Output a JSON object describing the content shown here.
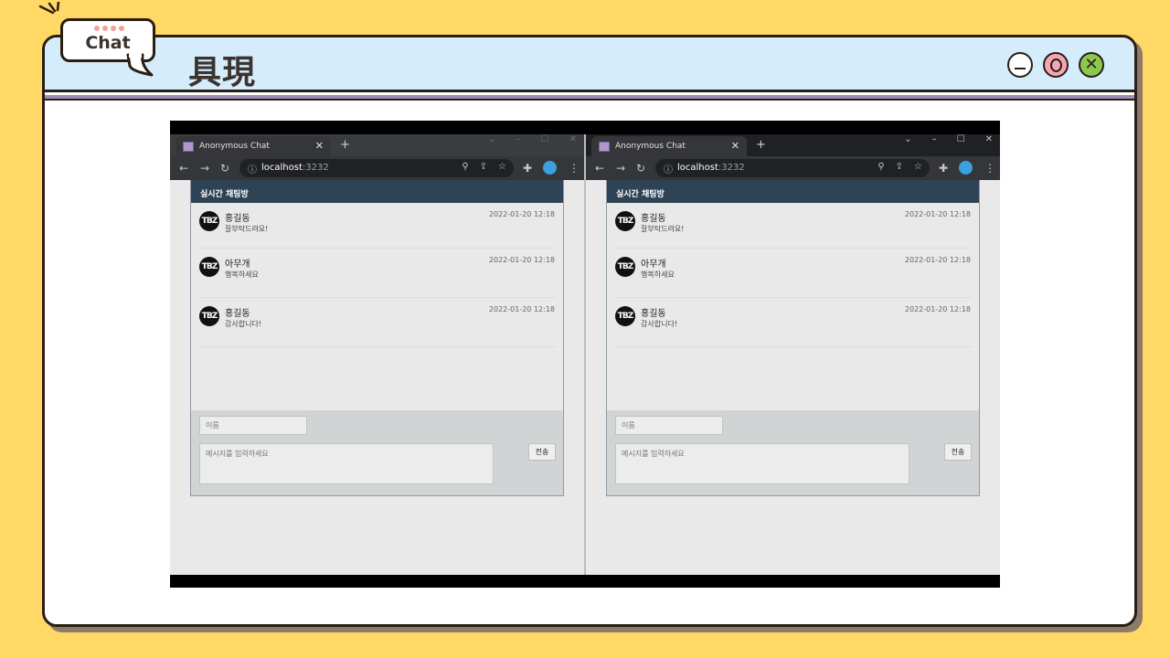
{
  "slide": {
    "title": "具現",
    "sticker_label": "Chat"
  },
  "colors": {
    "background": "#ffd866",
    "header": "#d5ecfb",
    "stripe": "#a08cb8",
    "chat_header": "#2f4356"
  },
  "icons": [
    "minimize-icon",
    "maximize-icon",
    "close-icon",
    "back-icon",
    "forward-icon",
    "reload-icon",
    "info-icon",
    "zoom-icon",
    "share-icon",
    "star-icon",
    "extension-icon",
    "menu-icon"
  ],
  "browsers": [
    {
      "tab_title": "Anonymous Chat",
      "url_host": "localhost",
      "url_port": ":3232",
      "chat": {
        "header": "실시간 채팅방",
        "messages": [
          {
            "avatar": "TBZ",
            "name": "홍길동",
            "text": "잘부탁드려요!",
            "time": "2022-01-20 12:18"
          },
          {
            "avatar": "TBZ",
            "name": "아무개",
            "text": "행복하세요",
            "time": "2022-01-20 12:18"
          },
          {
            "avatar": "TBZ",
            "name": "홍길동",
            "text": "감사합니다!",
            "time": "2022-01-20 12:18"
          }
        ],
        "name_placeholder": "이름",
        "message_placeholder": "메시지를 입력하세요",
        "send_label": "전송"
      }
    },
    {
      "tab_title": "Anonymous Chat",
      "url_host": "localhost",
      "url_port": ":3232",
      "chat": {
        "header": "실시간 채팅방",
        "messages": [
          {
            "avatar": "TBZ",
            "name": "홍길동",
            "text": "잘부탁드려요!",
            "time": "2022-01-20 12:18"
          },
          {
            "avatar": "TBZ",
            "name": "아무개",
            "text": "행복하세요",
            "time": "2022-01-20 12:18"
          },
          {
            "avatar": "TBZ",
            "name": "홍길동",
            "text": "감사합니다!",
            "time": "2022-01-20 12:18"
          }
        ],
        "name_placeholder": "이름",
        "message_placeholder": "메시지를 입력하세요",
        "send_label": "전송"
      }
    }
  ]
}
